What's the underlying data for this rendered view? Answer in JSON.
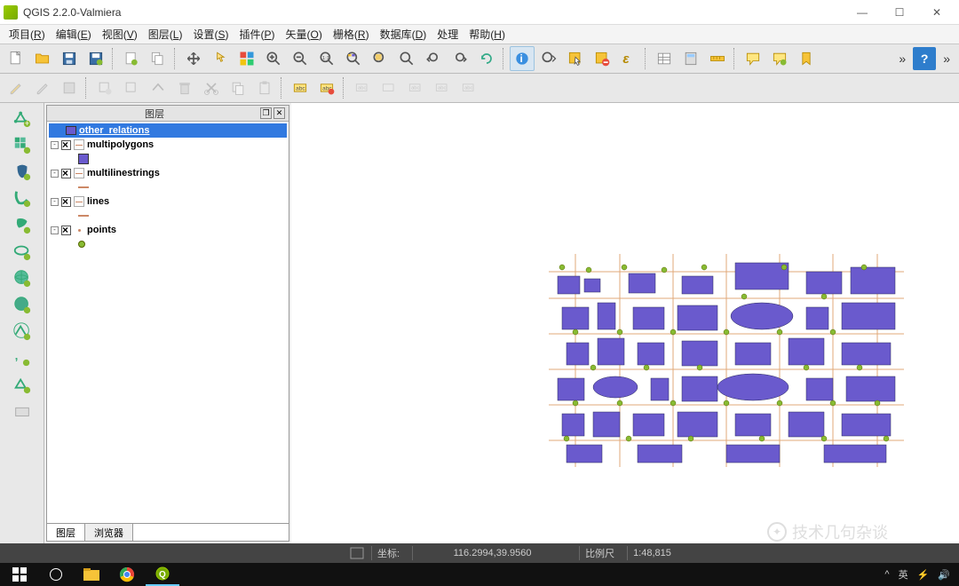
{
  "window": {
    "title": "QGIS 2.2.0-Valmiera",
    "min": "—",
    "max": "☐",
    "close": "✕"
  },
  "menus": [
    {
      "label": "项目",
      "key": "R"
    },
    {
      "label": "编辑",
      "key": "E"
    },
    {
      "label": "视图",
      "key": "V"
    },
    {
      "label": "图层",
      "key": "L"
    },
    {
      "label": "设置",
      "key": "S"
    },
    {
      "label": "插件",
      "key": "P"
    },
    {
      "label": "矢量",
      "key": "O"
    },
    {
      "label": "栅格",
      "key": "R"
    },
    {
      "label": "数据库",
      "key": "D"
    },
    {
      "label": "处理",
      "key": ""
    },
    {
      "label": "帮助",
      "key": "H"
    }
  ],
  "toolbar_more": "»",
  "panel": {
    "title": "图层",
    "tabs": {
      "layers": "图层",
      "browser": "浏览器"
    }
  },
  "layers": [
    {
      "name": "other_relations",
      "selected": true
    },
    {
      "name": "multipolygons",
      "expanded": true,
      "symbol": "poly"
    },
    {
      "name": "multilinestrings",
      "expanded": true,
      "symbol": "line"
    },
    {
      "name": "lines",
      "expanded": true,
      "symbol": "line"
    },
    {
      "name": "points",
      "expanded": true,
      "symbol": "pt"
    }
  ],
  "status": {
    "coord_label": "坐标:",
    "coord_value": "116.2994,39.9560",
    "scale_label": "比例尺",
    "scale_value": "1:48,815"
  },
  "watermark": "技术几句杂谈",
  "tray": {
    "lang": "英"
  }
}
